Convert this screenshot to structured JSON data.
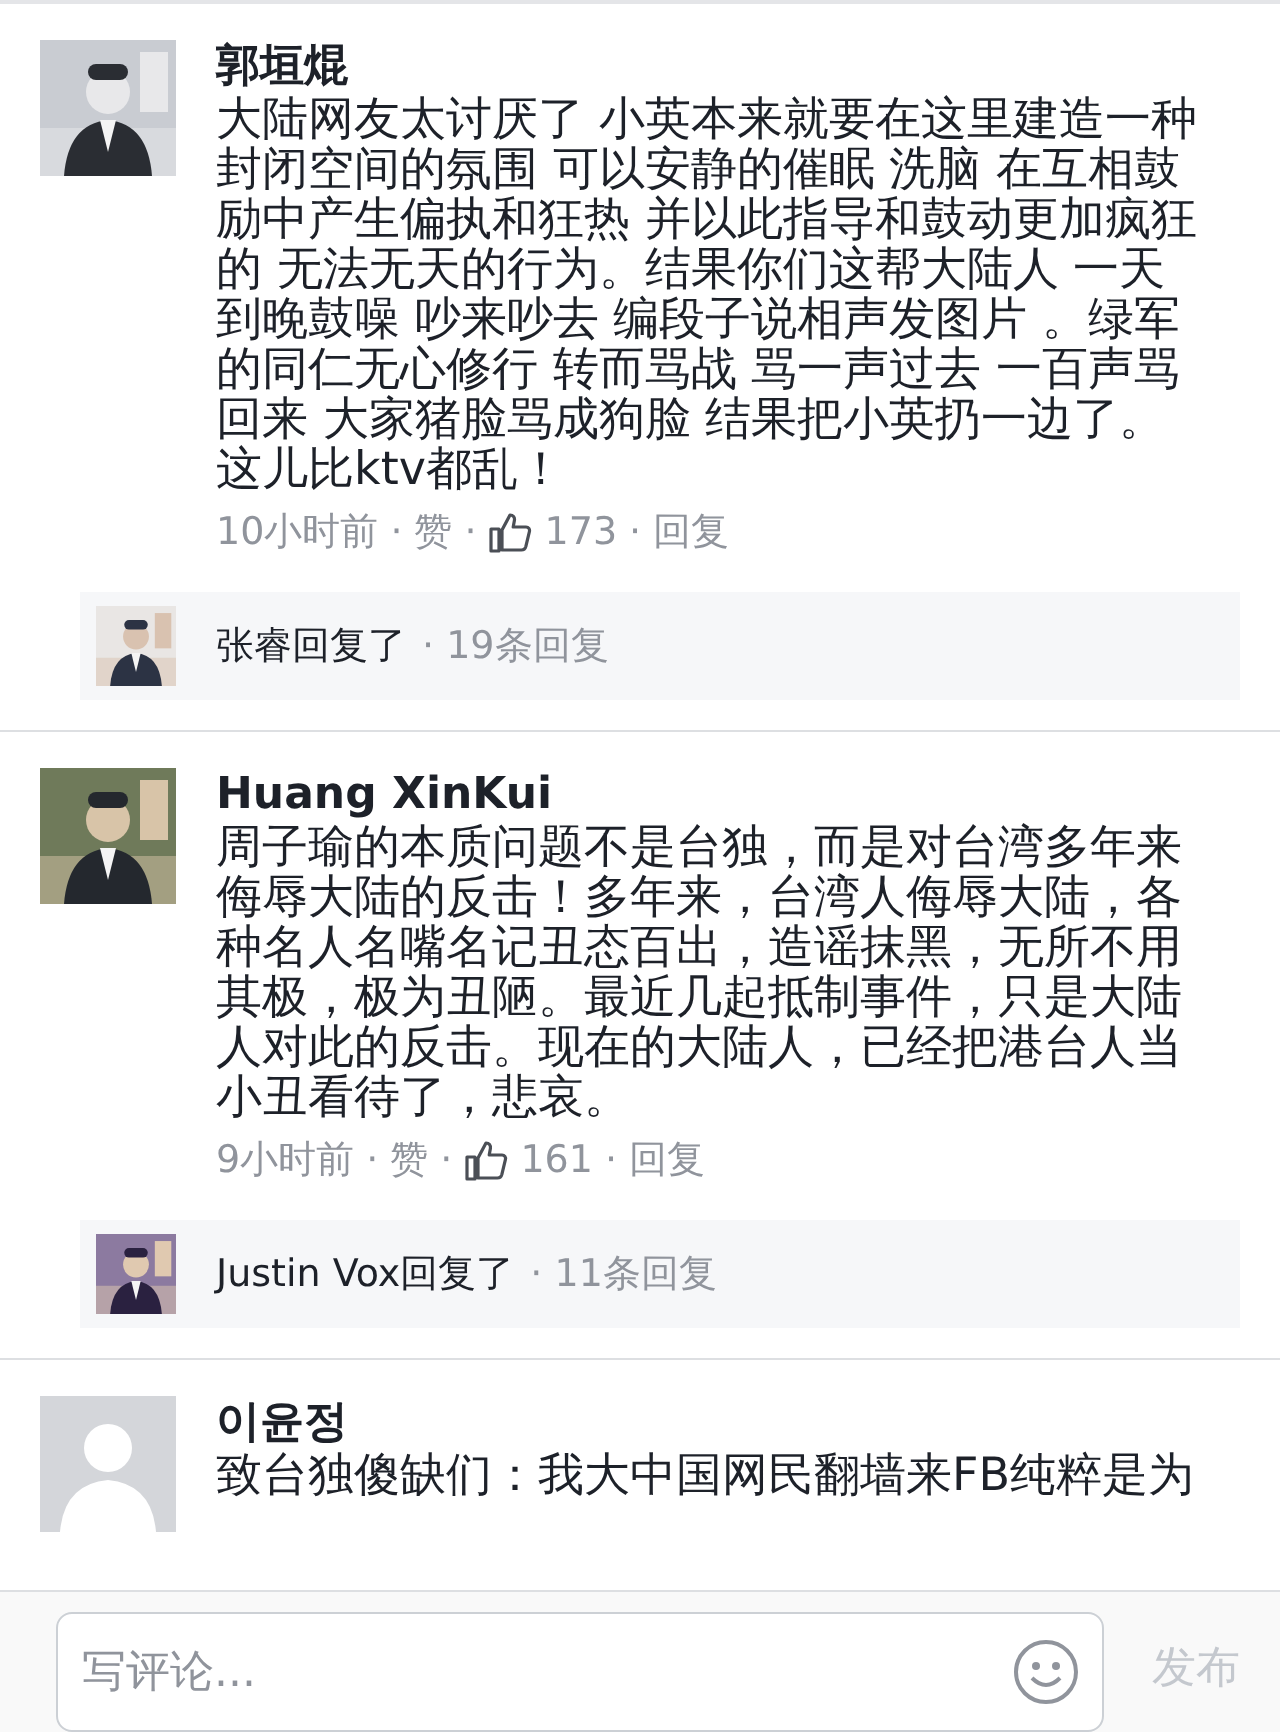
{
  "comments": [
    {
      "author": "郭垣焜",
      "text": "大陆网友太讨厌了 小英本来就要在这里建造一种封闭空间的氛围 可以安静的催眠 洗脑 在互相鼓励中产生偏执和狂热 并以此指导和鼓动更加疯狂的 无法无天的行为。结果你们这帮大陆人 一天到晚鼓噪 吵来吵去 编段子说相声发图片 。绿军的同仁无心修行 转而骂战 骂一声过去 一百声骂回来 大家猪脸骂成狗脸 结果把小英扔一边了。这儿比ktv都乱！",
      "time": "10小时前",
      "separator": "·",
      "like": "赞",
      "likes": "173",
      "reply": "回复",
      "replies": {
        "author_text": "张睿回复了",
        "count": "· 19条回复"
      }
    },
    {
      "author": "Huang XinKui",
      "text": "周子瑜的本质问题不是台独，而是对台湾多年来侮辱大陆的反击！多年来，台湾人侮辱大陆，各种名人名嘴名记丑态百出，造谣抹黑，无所不用其极，极为丑陋。最近几起抵制事件，只是大陆人对此的反击。现在的大陆人，已经把港台人当小丑看待了，悲哀。",
      "time": "9小时前",
      "separator": "·",
      "like": "赞",
      "likes": "161",
      "reply": "回复",
      "replies": {
        "author_text": "Justin Vox回复了",
        "count": "· 11条回复"
      }
    },
    {
      "author": "이윤정",
      "avatar": {
        "kind": "silhouette"
      },
      "text": "致台独傻缺们：我大中国网民翻墙来FB纯粹是为"
    }
  ],
  "composer": {
    "placeholder": "写评论...",
    "post": "发布"
  }
}
